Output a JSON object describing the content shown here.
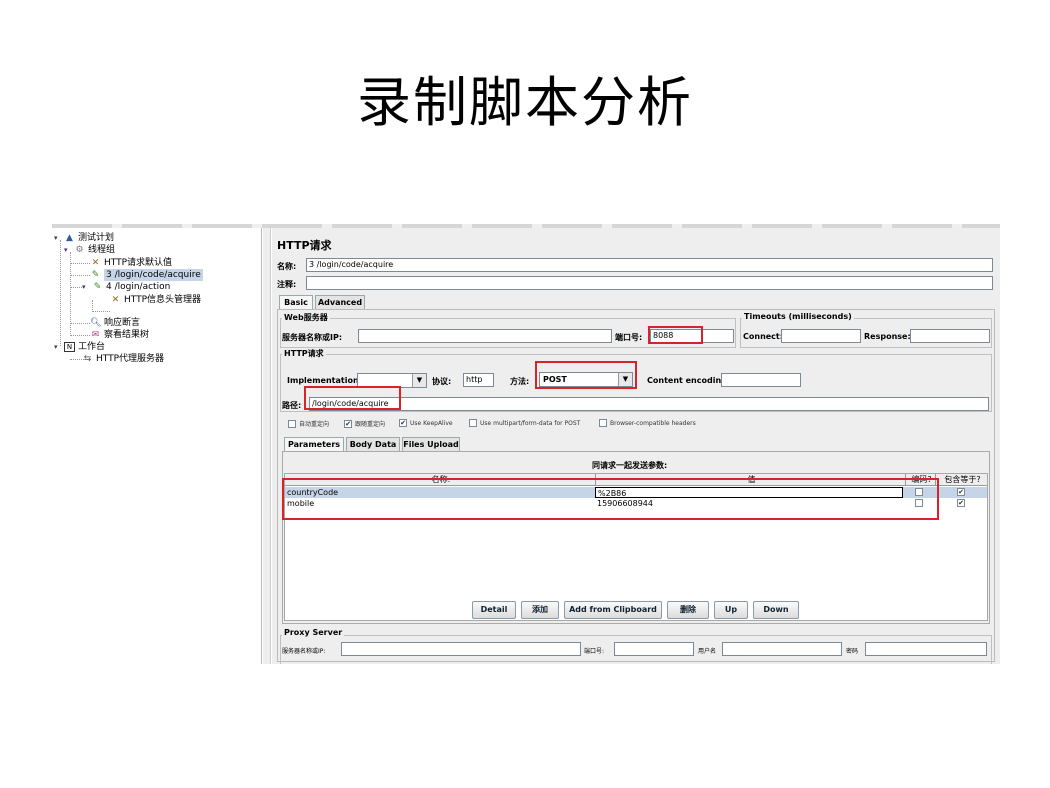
{
  "slide_title": "录制脚本分析",
  "tree": {
    "items": [
      {
        "label": "测试计划",
        "icon": "test-plan-icon"
      },
      {
        "label": "线程组",
        "icon": "thread-group-icon"
      },
      {
        "label": "HTTP请求默认值",
        "icon": "config-icon"
      },
      {
        "label": "3 /login/code/acquire",
        "icon": "sampler-icon"
      },
      {
        "label": "4 /login/action",
        "icon": "sampler-icon"
      },
      {
        "label": "HTTP信息头管理器",
        "icon": "config-icon"
      },
      {
        "label": "响应断言",
        "icon": "assertion-icon"
      },
      {
        "label": "察看结果树",
        "icon": "listener-icon"
      },
      {
        "label": "工作台",
        "icon": "workbench-icon"
      },
      {
        "label": "HTTP代理服务器",
        "icon": "proxy-icon"
      }
    ]
  },
  "panel": {
    "title": "HTTP请求",
    "name_label": "名称:",
    "name_value": "3 /login/code/acquire",
    "comment_label": "注释:",
    "tabs": [
      "Basic",
      "Advanced"
    ],
    "web_server": {
      "title": "Web服务器",
      "server_label": "服务器名称或IP:",
      "server_value": "",
      "port_label": "端口号:",
      "port_value": "8088"
    },
    "timeouts": {
      "title": "Timeouts (milliseconds)",
      "connect_label": "Connect:",
      "response_label": "Response:"
    },
    "http_request": {
      "title": "HTTP请求",
      "impl_label": "Implementation:",
      "protocol_label": "协议:",
      "protocol_value": "http",
      "method_label": "方法:",
      "method_value": "POST",
      "encoding_label": "Content encoding:",
      "path_label": "路径:",
      "path_value": "/login/code/acquire"
    },
    "checkboxes": [
      {
        "label": "自动重定向",
        "checked": false
      },
      {
        "label": "跟随重定向",
        "checked": true
      },
      {
        "label": "Use KeepAlive",
        "checked": true
      },
      {
        "label": "Use multipart/form-data for POST",
        "checked": false
      },
      {
        "label": "Browser-compatible headers",
        "checked": false
      }
    ],
    "param_tabs": [
      "Parameters",
      "Body Data",
      "Files Upload"
    ],
    "params_caption": "同请求一起发送参数:",
    "columns": [
      "名称:",
      "值",
      "编码?",
      "包含等于?"
    ],
    "rows": [
      {
        "name": "countryCode",
        "value": "%2B86",
        "encode": false,
        "include_equals": true
      },
      {
        "name": "mobile",
        "value": "15906608944",
        "encode": false,
        "include_equals": true
      }
    ],
    "buttons": [
      "Detail",
      "添加",
      "Add from Clipboard",
      "删除",
      "Up",
      "Down"
    ],
    "proxy": {
      "title": "Proxy Server",
      "server_label": "服务器名称或IP:",
      "port_label": "端口号:",
      "user_label": "用户名",
      "password_label": "密码"
    },
    "checkmark": "✔"
  },
  "colors": {
    "highlight": "#d8232a",
    "selection": "#c6d4e8"
  }
}
